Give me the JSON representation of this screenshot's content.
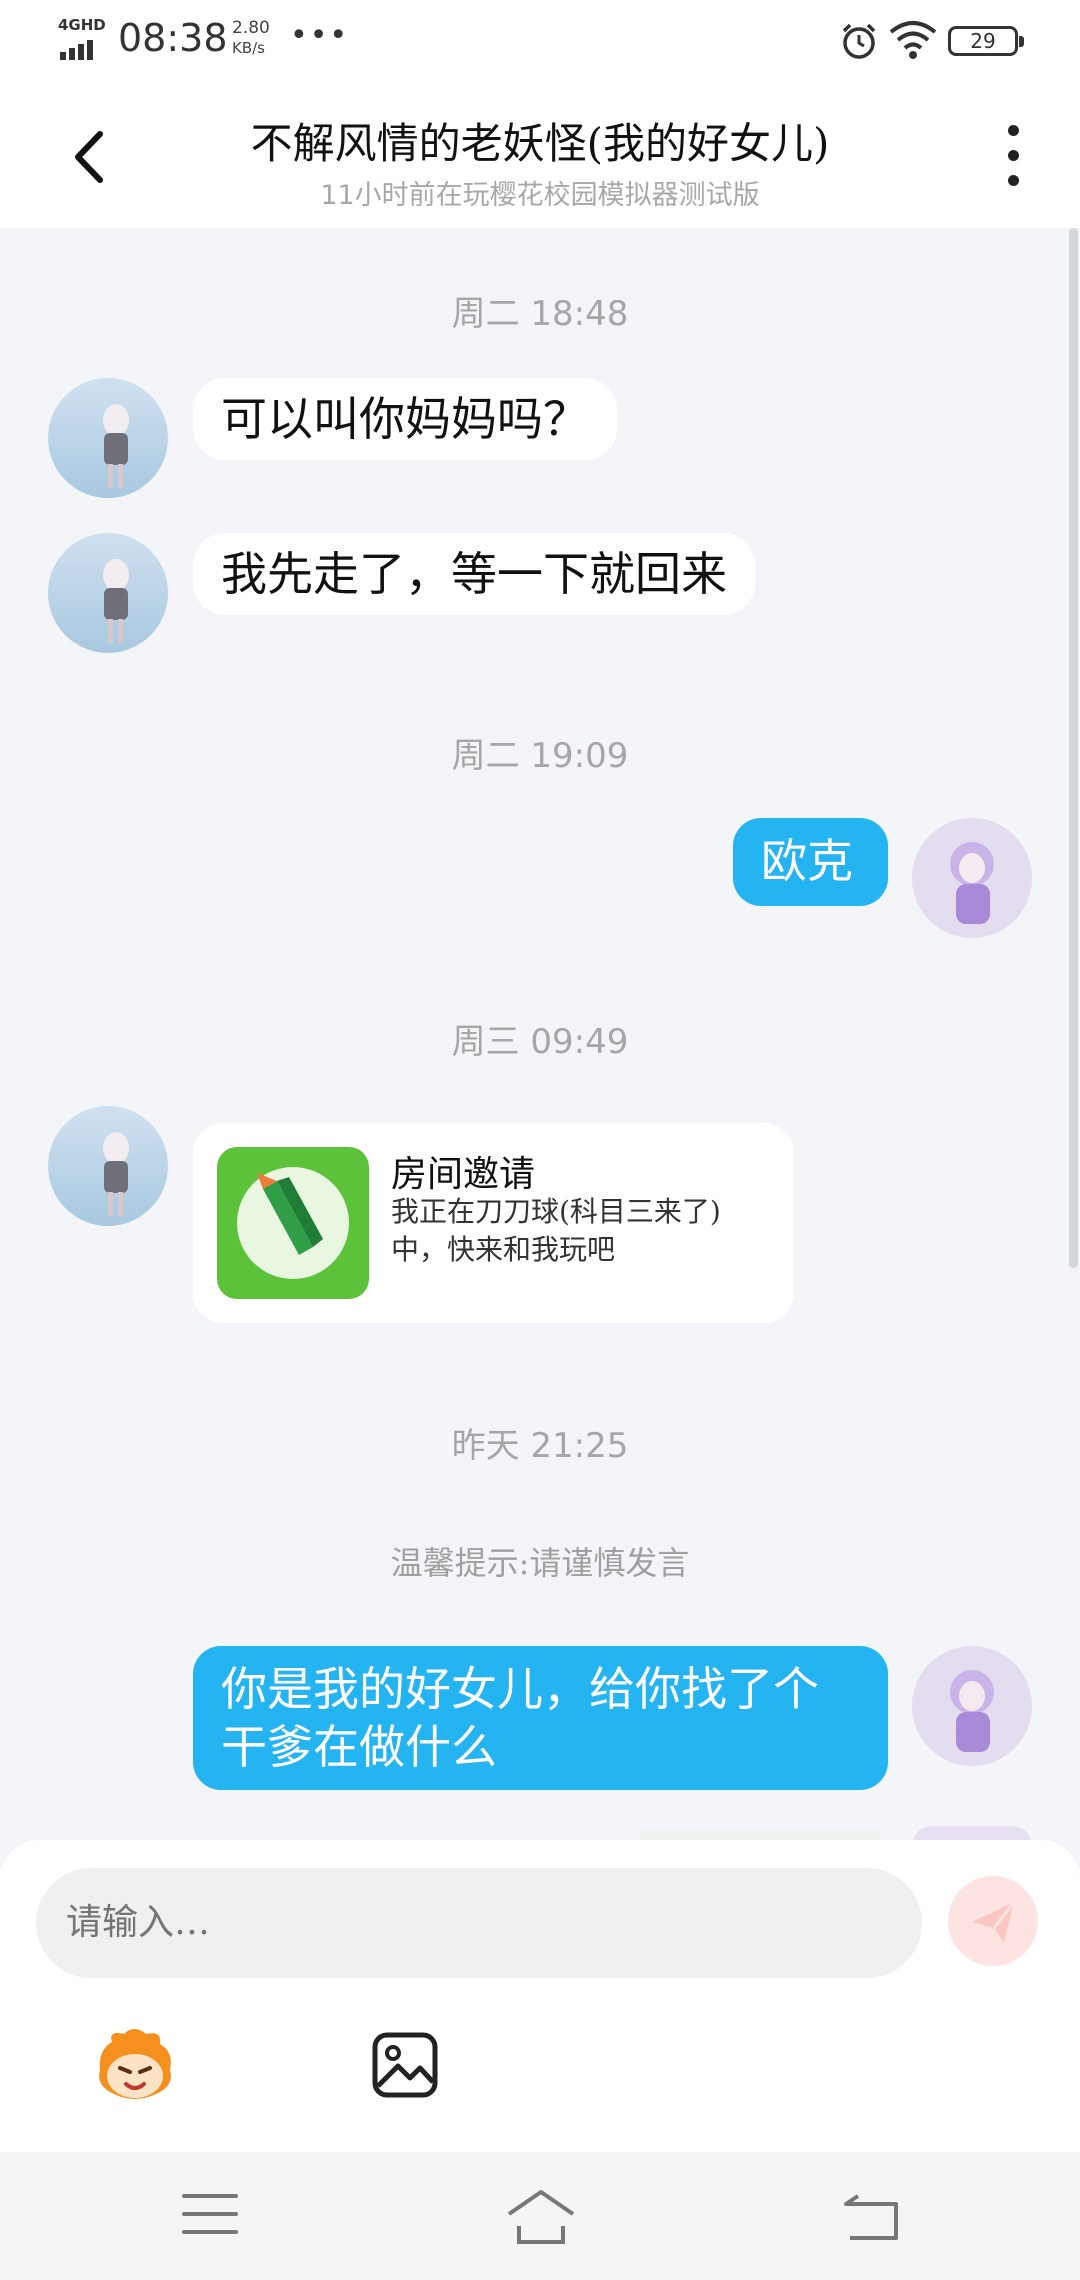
{
  "status_bar": {
    "network_type": "4GHD",
    "time": "08:38",
    "speed_value": "2.80",
    "speed_unit": "KB/s",
    "overflow": "•••",
    "battery": "29"
  },
  "header": {
    "title": "不解风情的老妖怪(我的好女儿)",
    "subtitle": "11小时前在玩樱花校园模拟器测试版"
  },
  "messages": {
    "ts1": "周二 18:48",
    "msg1": "可以叫你妈妈吗？",
    "msg2": "我先走了，等一下就回来",
    "ts2": "周二 19:09",
    "msg3": "欧克",
    "ts3": "周三 09:49",
    "card": {
      "title": "房间邀请",
      "desc": "我正在刀刀球(科目三来了)中，快来和我玩吧"
    },
    "ts4": "昨天 21:25",
    "hint": "温馨提示:请谨慎发言",
    "msg4": "你是我的好女儿，给你找了个干爹在做什么"
  },
  "composer": {
    "placeholder": "请输入…"
  },
  "colors": {
    "accent_blue": "#25b4f2",
    "background": "#f3f5f8"
  }
}
